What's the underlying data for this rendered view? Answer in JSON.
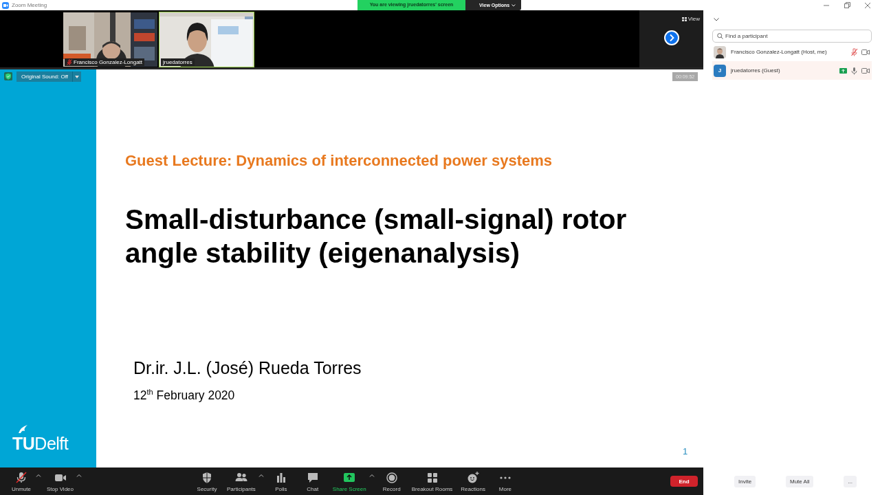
{
  "window": {
    "title": "Zoom Meeting"
  },
  "banner": {
    "text": "You are viewing jruedatorres' screen",
    "options": "View Options"
  },
  "videos": [
    {
      "kind": "lab",
      "name": "Francisco Gonzalez-Longatt",
      "muted": true,
      "speaking": false
    },
    {
      "kind": "office",
      "name": "jruedatorres",
      "muted": false,
      "speaking": true
    }
  ],
  "video_strip": {
    "view_button": "View"
  },
  "original_sound": "Original Sound: Off",
  "timer": "00:09:52",
  "slide": {
    "subtitle": "Guest Lecture: Dynamics of interconnected power systems",
    "title": "Small-disturbance (small-signal) rotor angle stability (eigenanalysis)",
    "author": "Dr.ir. J.L. (José) Rueda Torres",
    "date": "12$^{th}$ February 2020",
    "logo": "**TU**Delft",
    "page": "1"
  },
  "toolbar": [
    {
      "kind": "mic",
      "label": "Unmute",
      "muted": true,
      "menu": true,
      "highlighted": false
    },
    {
      "kind": "video",
      "label": "Stop Video",
      "muted": false,
      "menu": true,
      "highlighted": false
    },
    {
      "kind": "security",
      "label": "Security",
      "muted": false,
      "menu": false,
      "highlighted": false
    },
    {
      "kind": "participants",
      "label": "Participants",
      "muted": false,
      "menu": true,
      "highlighted": false
    },
    {
      "kind": "polls",
      "label": "Polls",
      "muted": false,
      "menu": false,
      "highlighted": false
    },
    {
      "kind": "chat",
      "label": "Chat",
      "muted": false,
      "menu": false,
      "highlighted": false
    },
    {
      "kind": "share",
      "label": "Share Screen",
      "muted": false,
      "menu": true,
      "highlighted": true
    },
    {
      "kind": "record",
      "label": "Record",
      "muted": false,
      "menu": false,
      "highlighted": false
    },
    {
      "kind": "breakout",
      "label": "Breakout Rooms",
      "muted": false,
      "menu": false,
      "highlighted": false
    },
    {
      "kind": "reactions",
      "label": "Reactions",
      "muted": false,
      "menu": false,
      "highlighted": false
    },
    {
      "kind": "more",
      "label": "More",
      "muted": false,
      "menu": false,
      "highlighted": false
    }
  ],
  "end_button": "End",
  "panel": {
    "search_placeholder": "Find a participant",
    "participants": [
      {
        "name": "Francisco Gonzalez-Longatt (Host, me)",
        "muted": true,
        "sharing": false,
        "selected": false
      },
      {
        "initial": "J",
        "name": "jruedatorres (Guest)",
        "muted": false,
        "sharing": true,
        "selected": true
      }
    ],
    "buttons": [
      "Invite",
      "Mute All",
      "..."
    ]
  }
}
